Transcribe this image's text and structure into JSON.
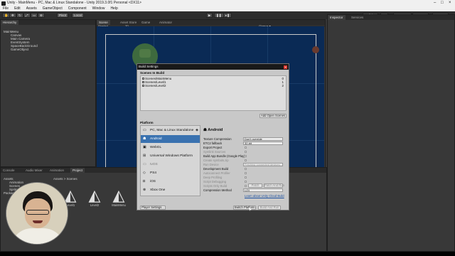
{
  "window": {
    "title": "Unity - MainMenu - PC, Mac & Linux Standalone - Unity 2019.3.0f1 Personal <DX11>"
  },
  "menu": [
    "File",
    "Edit",
    "Assets",
    "GameObject",
    "Component",
    "Window",
    "Help"
  ],
  "toolbar": {
    "pivot": "Pivot",
    "local": "Local",
    "collab": "Collab ▾",
    "account": "Account ▾",
    "layers": "Layers ▾",
    "layout": "Layout ▾"
  },
  "hierarchy": {
    "tab": "Hierarchy",
    "items": [
      "MainMenu",
      "Canvas",
      "Main Camera",
      "EventSystem",
      "SpaceBackGround",
      "GameObject"
    ]
  },
  "scene": {
    "tabs": [
      "Scene",
      "Asset Store",
      "Game",
      "Animator"
    ],
    "shading": "Shaded",
    "mode": "2D",
    "gizmos": "Gizmos ▾"
  },
  "inspector": {
    "tabs": [
      "Inspector",
      "Services"
    ]
  },
  "project": {
    "tabs": [
      "Console",
      "Audio Mixer",
      "Animation",
      "Project"
    ],
    "breadcrumb": "Assets > Scenes",
    "tree": [
      "Assets",
      "Animation",
      "Scenes",
      "Sprites",
      "Packages"
    ],
    "assets": [
      "Level1",
      "Level2",
      "MainMenu"
    ]
  },
  "build_settings": {
    "title": "Build Settings",
    "scenes_header": "Scenes In Build",
    "scenes": [
      {
        "name": "Scenes/MainMenu",
        "index": "0"
      },
      {
        "name": "Scenes/Level1",
        "index": "1"
      },
      {
        "name": "Scenes/Level2",
        "index": "2"
      }
    ],
    "add_open_scenes": "Add Open Scenes",
    "platform_header": "Platform",
    "platforms": [
      {
        "name": "PC, Mac & Linux Standalone",
        "icon": "monitor-icon"
      },
      {
        "name": "Android",
        "icon": "android-icon"
      },
      {
        "name": "WebGL",
        "icon": "html5-icon"
      },
      {
        "name": "Universal Windows Platform",
        "icon": "windows-icon"
      },
      {
        "name": "tvOS",
        "icon": "tv-icon"
      },
      {
        "name": "PS4",
        "icon": "ps4-icon"
      },
      {
        "name": "iOS",
        "icon": "ios-icon"
      },
      {
        "name": "Xbox One",
        "icon": "xbox-icon"
      }
    ],
    "selected_platform": "Android",
    "settings": [
      {
        "label": "Texture Compression",
        "value": "Don't override"
      },
      {
        "label": "ETC2 fallback",
        "value": "32-bit"
      },
      {
        "label": "Export Project",
        "value": ""
      },
      {
        "label": "Symlink Sources",
        "value": ""
      },
      {
        "label": "Build App Bundle (Google Play)",
        "value": ""
      },
      {
        "label": "Create symbols.zip",
        "value": ""
      },
      {
        "label": "Run Device",
        "value": "Fetching connected devices..."
      },
      {
        "label": "Development Build",
        "value": ""
      },
      {
        "label": "Autoconnect Profiler",
        "value": ""
      },
      {
        "label": "Deep Profiling",
        "value": ""
      },
      {
        "label": "Script Debugging",
        "value": ""
      },
      {
        "label": "Scripts Only Build",
        "value": ""
      },
      {
        "label": "Compression Method",
        "value": "LZ4"
      }
    ],
    "patch": "Patch",
    "patch_and_run": "Patch And Run",
    "cloud_link": "Learn about Unity Cloud Build",
    "player_settings": "Player Settings...",
    "switch_platform": "Switch Platform",
    "build_and_run": "Build And Run"
  }
}
